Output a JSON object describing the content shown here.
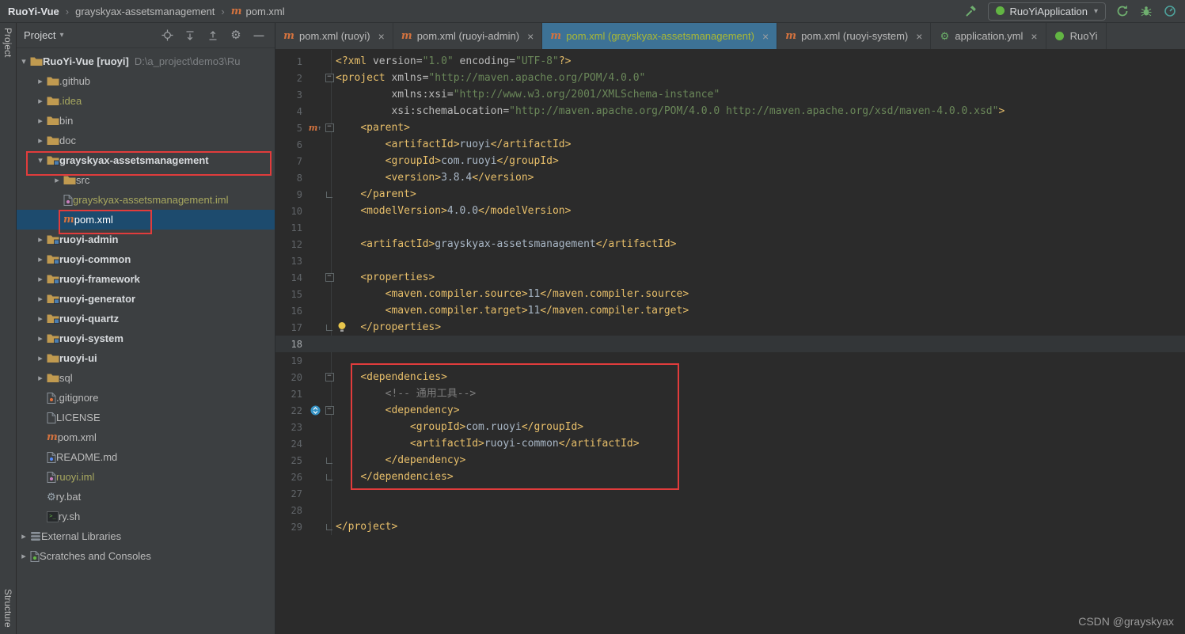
{
  "window": {
    "breadcrumb": [
      {
        "label": "RuoYi-Vue",
        "bold": true
      },
      {
        "label": "grayskyax-assetsmanagement",
        "bold": false
      },
      {
        "label": "pom.xml",
        "bold": false,
        "icon": "maven-file-icon"
      }
    ],
    "run_widget": {
      "config_name": "RuoYiApplication",
      "left_icons": [
        "build-hammer-icon"
      ],
      "right_icons": [
        "rerun-icon",
        "debug-icon",
        "profiler-icon"
      ]
    }
  },
  "tool_strip": {
    "top": "Project",
    "bottom": "Structure"
  },
  "project_panel": {
    "title": "Project",
    "header_icons": [
      "locate-file-icon",
      "expand-all-icon",
      "collapse-all-icon",
      "settings-gear-icon",
      "hide-panel-icon"
    ],
    "tree": [
      {
        "label": "RuoYi-Vue [ruoyi]",
        "path": "D:\\a_project\\demo3\\Ru",
        "level": 0,
        "arrow": "down",
        "icon": "project-folder-icon",
        "bold": true
      },
      {
        "label": ".github",
        "level": 1,
        "arrow": "right",
        "icon": "folder-icon"
      },
      {
        "label": ".idea",
        "level": 1,
        "arrow": "right",
        "icon": "folder-icon",
        "cls": "ignored"
      },
      {
        "label": "bin",
        "level": 1,
        "arrow": "right",
        "icon": "folder-icon"
      },
      {
        "label": "doc",
        "level": 1,
        "arrow": "right",
        "icon": "folder-icon"
      },
      {
        "label": "grayskyax-assetsmanagement",
        "level": 1,
        "arrow": "down",
        "icon": "module-folder-icon",
        "bold": true
      },
      {
        "label": "src",
        "level": 2,
        "arrow": "right",
        "icon": "folder-icon"
      },
      {
        "label": "grayskyax-assetsmanagement.iml",
        "level": 2,
        "arrow": null,
        "icon": "iml-file-icon",
        "cls": "ignored"
      },
      {
        "label": "pom.xml",
        "level": 2,
        "arrow": null,
        "icon": "maven-file-icon",
        "selected": true
      },
      {
        "label": "ruoyi-admin",
        "level": 1,
        "arrow": "right",
        "icon": "module-folder-icon",
        "bold": true
      },
      {
        "label": "ruoyi-common",
        "level": 1,
        "arrow": "right",
        "icon": "module-folder-icon",
        "bold": true
      },
      {
        "label": "ruoyi-framework",
        "level": 1,
        "arrow": "right",
        "icon": "module-folder-icon",
        "bold": true
      },
      {
        "label": "ruoyi-generator",
        "level": 1,
        "arrow": "right",
        "icon": "module-folder-icon",
        "bold": true
      },
      {
        "label": "ruoyi-quartz",
        "level": 1,
        "arrow": "right",
        "icon": "module-folder-icon",
        "bold": true
      },
      {
        "label": "ruoyi-system",
        "level": 1,
        "arrow": "right",
        "icon": "module-folder-icon",
        "bold": true
      },
      {
        "label": "ruoyi-ui",
        "level": 1,
        "arrow": "right",
        "icon": "folder-icon",
        "bold": true
      },
      {
        "label": "sql",
        "level": 1,
        "arrow": "right",
        "icon": "folder-icon"
      },
      {
        "label": ".gitignore",
        "level": 1,
        "arrow": null,
        "icon": "gitignore-file-icon"
      },
      {
        "label": "LICENSE",
        "level": 1,
        "arrow": null,
        "icon": "text-file-icon"
      },
      {
        "label": "pom.xml",
        "level": 1,
        "arrow": null,
        "icon": "maven-file-icon"
      },
      {
        "label": "README.md",
        "level": 1,
        "arrow": null,
        "icon": "markdown-file-icon"
      },
      {
        "label": "ruoyi.iml",
        "level": 1,
        "arrow": null,
        "icon": "iml-file-icon",
        "cls": "ignored"
      },
      {
        "label": "ry.bat",
        "level": 1,
        "arrow": null,
        "icon": "bat-file-icon"
      },
      {
        "label": "ry.sh",
        "level": 1,
        "arrow": null,
        "icon": "sh-file-icon"
      },
      {
        "label": "External Libraries",
        "level": 0,
        "arrow": "right",
        "icon": "libraries-icon"
      },
      {
        "label": "Scratches and Consoles",
        "level": 0,
        "arrow": "right",
        "icon": "scratches-icon"
      }
    ]
  },
  "editor": {
    "tabs": [
      {
        "icon": "maven-file-icon",
        "label": "pom.xml (ruoyi)",
        "active": false,
        "closable": true
      },
      {
        "icon": "maven-file-icon",
        "label": "pom.xml (ruoyi-admin)",
        "active": false,
        "closable": true
      },
      {
        "icon": "maven-file-icon",
        "label": "pom.xml (grayskyax-assetsmanagement)",
        "active": true,
        "closable": true
      },
      {
        "icon": "maven-file-icon",
        "label": "pom.xml (ruoyi-system)",
        "active": false,
        "closable": true
      },
      {
        "icon": "yml-file-icon",
        "label": "application.yml",
        "active": false,
        "closable": true
      },
      {
        "icon": "spring-boot-icon",
        "label": "RuoYi",
        "active": false,
        "closable": false
      }
    ],
    "caret_line": 18,
    "fold_starts": [
      2,
      5,
      14,
      20,
      22
    ],
    "fold_ends": [
      9,
      17,
      25,
      26,
      29
    ],
    "gutter_icons": [
      {
        "line": 5,
        "icon": "maven-gutter-icon"
      },
      {
        "line": 17,
        "icon": "bulb-icon"
      },
      {
        "line": 22,
        "icon": "dependency-gutter-icon"
      }
    ],
    "code_lines": [
      "<?xml version=\"1.0\" encoding=\"UTF-8\"?>",
      "<project xmlns=\"http://maven.apache.org/POM/4.0.0\"",
      "         xmlns:xsi=\"http://www.w3.org/2001/XMLSchema-instance\"",
      "         xsi:schemaLocation=\"http://maven.apache.org/POM/4.0.0 http://maven.apache.org/xsd/maven-4.0.0.xsd\">",
      "    <parent>",
      "        <artifactId>ruoyi</artifactId>",
      "        <groupId>com.ruoyi</groupId>",
      "        <version>3.8.4</version>",
      "    </parent>",
      "    <modelVersion>4.0.0</modelVersion>",
      "",
      "    <artifactId>grayskyax-assetsmanagement</artifactId>",
      "",
      "    <properties>",
      "        <maven.compiler.source>11</maven.compiler.source>",
      "        <maven.compiler.target>11</maven.compiler.target>",
      "    </properties>",
      "",
      "",
      "    <dependencies>",
      "        <!-- 通用工具-->",
      "        <dependency>",
      "            <groupId>com.ruoyi</groupId>",
      "            <artifactId>ruoyi-common</artifactId>",
      "        </dependency>",
      "    </dependencies>",
      "",
      "",
      "</project>"
    ]
  },
  "watermark": "CSDN @grayskyax",
  "colors": {
    "annotation": "#e13c3c",
    "selection": "#1d4b6e",
    "active_tab_bg": "#3d7296",
    "active_tab_text": "#aab834",
    "caret_line": "#333638",
    "tag": "#e8bf6a",
    "attr": "#bababa",
    "string": "#6a8759",
    "text": "#a9b7c6",
    "comment": "#7f7f7f",
    "maven_orange": "#d4733f",
    "ignored": "#a8a85f",
    "spring_green": "#62b543"
  }
}
